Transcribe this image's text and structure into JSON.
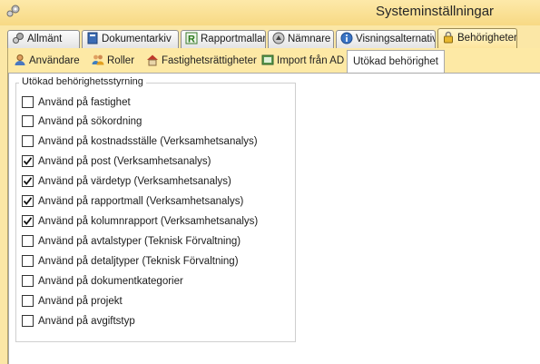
{
  "window": {
    "title": "Systeminställningar"
  },
  "main_tabs": [
    {
      "label": "Allmänt",
      "icon": "gears-icon",
      "active": false
    },
    {
      "label": "Dokumentarkiv",
      "icon": "binder-icon",
      "active": false
    },
    {
      "label": "Rapportmallar",
      "icon": "report-r-icon",
      "active": false
    },
    {
      "label": "Nämnare",
      "icon": "scale-icon",
      "active": false
    },
    {
      "label": "Visningsalternativ",
      "icon": "info-icon",
      "active": false
    },
    {
      "label": "Behörigheter",
      "icon": "lock-icon",
      "active": true
    }
  ],
  "sub_tabs": [
    {
      "label": "Användare",
      "icon": "user-icon",
      "active": false
    },
    {
      "label": "Roller",
      "icon": "users-icon",
      "active": false
    },
    {
      "label": "Fastighetsrättigheter",
      "icon": "house-icon",
      "active": false
    },
    {
      "label": "Import från AD",
      "icon": "import-icon",
      "active": false
    },
    {
      "label": "Utökad behörighet",
      "icon": "",
      "active": true
    }
  ],
  "group": {
    "legend": "Utökad behörighetsstyrning",
    "options": [
      {
        "label": "Använd på fastighet",
        "checked": false
      },
      {
        "label": "Använd på sökordning",
        "checked": false
      },
      {
        "label": "Använd på kostnadsställe (Verksamhetsanalys)",
        "checked": false
      },
      {
        "label": "Använd på post (Verksamhetsanalys)",
        "checked": true
      },
      {
        "label": "Använd på värdetyp (Verksamhetsanalys)",
        "checked": true
      },
      {
        "label": "Använd på rapportmall (Verksamhetsanalys)",
        "checked": true
      },
      {
        "label": "Använd på kolumnrapport (Verksamhetsanalys)",
        "checked": true
      },
      {
        "label": "Använd på avtalstyper (Teknisk Förvaltning)",
        "checked": false
      },
      {
        "label": "Använd på detaljtyper (Teknisk Förvaltning)",
        "checked": false
      },
      {
        "label": "Använd på dokumentkategorier",
        "checked": false
      },
      {
        "label": "Använd på projekt",
        "checked": false
      },
      {
        "label": "Använd på avgiftstyp",
        "checked": false
      }
    ]
  },
  "colors": {
    "accent": "#fde9a5",
    "active_tab": "#fde49a",
    "content_bg": "#ffffff"
  }
}
